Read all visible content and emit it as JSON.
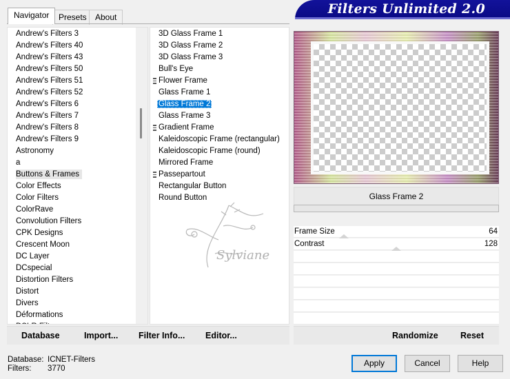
{
  "tabs": [
    {
      "label": "Navigator",
      "active": true
    },
    {
      "label": "Presets",
      "active": false
    },
    {
      "label": "About",
      "active": false
    }
  ],
  "banner": {
    "title": "Filters Unlimited 2.0",
    "color": "#0d0d8c"
  },
  "categories": [
    "Andrew's Filters 3",
    "Andrew's Filters 40",
    "Andrew's Filters 43",
    "Andrew's Filters 50",
    "Andrew's Filters 51",
    "Andrew's Filters 52",
    "Andrew's Filters 6",
    "Andrew's Filters 7",
    "Andrew's Filters 8",
    "Andrew's Filters 9",
    "Astronomy",
    "a",
    "Buttons & Frames",
    "Color Effects",
    "Color Filters",
    "ColorRave",
    "Convolution Filters",
    "CPK Designs",
    "Crescent Moon",
    "DC Layer",
    "DCspecial",
    "Distortion Filters",
    "Distort",
    "Divers",
    "Déformations",
    "DSLR Filters"
  ],
  "selected_category": "Buttons & Frames",
  "filters": [
    {
      "label": "3D Glass Frame 1",
      "group": false
    },
    {
      "label": "3D Glass Frame 2",
      "group": false
    },
    {
      "label": "3D Glass Frame 3",
      "group": false
    },
    {
      "label": "Bull's Eye",
      "group": false
    },
    {
      "label": "Flower Frame",
      "group": true
    },
    {
      "label": "Glass Frame 1",
      "group": false
    },
    {
      "label": "Glass Frame 2",
      "group": false
    },
    {
      "label": "Glass Frame 3",
      "group": false
    },
    {
      "label": "Gradient Frame",
      "group": true
    },
    {
      "label": "Kaleidoscopic Frame (rectangular)",
      "group": false
    },
    {
      "label": "Kaleidoscopic Frame (round)",
      "group": false
    },
    {
      "label": "Mirrored Frame",
      "group": false
    },
    {
      "label": "Passepartout",
      "group": true
    },
    {
      "label": "Rectangular Button",
      "group": false
    },
    {
      "label": "Round Button",
      "group": false
    }
  ],
  "selected_filter": "Glass Frame 2",
  "watermark": {
    "text": "Sylviane"
  },
  "preview": {
    "filter_name": "Glass Frame 2"
  },
  "params": [
    {
      "label": "Frame Size",
      "value": "64",
      "level": 0.25
    },
    {
      "label": "Contrast",
      "value": "128",
      "level": 0.5
    }
  ],
  "commands": {
    "database": "Database",
    "import": "Import...",
    "filter_info": "Filter Info...",
    "editor": "Editor...",
    "randomize": "Randomize",
    "reset": "Reset"
  },
  "footer": {
    "database_label": "Database:",
    "database_value": "ICNET-Filters",
    "filters_label": "Filters:",
    "filters_value": "3770"
  },
  "buttons": {
    "apply": "Apply",
    "cancel": "Cancel",
    "help": "Help"
  },
  "colors": {
    "selection": "#0078d7",
    "banner": "#0d0d8c"
  }
}
